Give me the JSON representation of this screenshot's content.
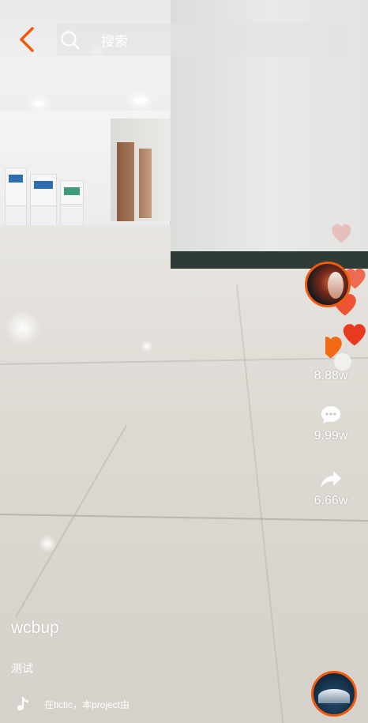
{
  "search": {
    "placeholder": "搜索"
  },
  "rail": {
    "likes": "8.88w",
    "comments": "9.99w",
    "shares": "6.66w"
  },
  "video": {
    "author": "wcbup",
    "description": "测试",
    "music_text": "在tictic，本project由"
  },
  "colors": {
    "accent": "#f05a0e",
    "heart": "#ef4422",
    "text": "#ffffff",
    "search_bg": "rgba(225,225,225,0.55)"
  },
  "icons": {
    "back": "chevron-left-icon",
    "search": "search-icon",
    "comment": "comment-bubble-icon",
    "share": "share-arrow-icon",
    "music": "music-note-icon"
  }
}
